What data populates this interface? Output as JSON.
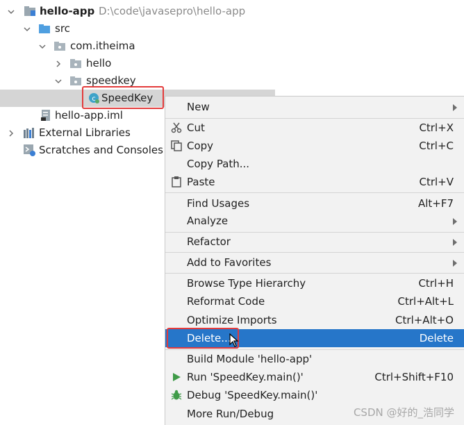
{
  "tree": {
    "project": {
      "name": "hello-app",
      "path": "D:\\code\\javasepro\\hello-app"
    },
    "src": "src",
    "package": "com.itheima",
    "hello": "hello",
    "speedkey": "speedkey",
    "speedkey_class": "SpeedKey",
    "iml": "hello-app.iml",
    "external": "External Libraries",
    "scratches": "Scratches and Consoles"
  },
  "menu": {
    "new": "New",
    "cut": "Cut",
    "cut_sc": "Ctrl+X",
    "copy": "Copy",
    "copy_sc": "Ctrl+C",
    "copy_path": "Copy Path...",
    "paste": "Paste",
    "paste_sc": "Ctrl+V",
    "find_usages": "Find Usages",
    "find_usages_sc": "Alt+F7",
    "analyze": "Analyze",
    "refactor": "Refactor",
    "add_favorites": "Add to Favorites",
    "browse_type": "Browse Type Hierarchy",
    "browse_type_sc": "Ctrl+H",
    "reformat": "Reformat Code",
    "reformat_sc": "Ctrl+Alt+L",
    "optimize": "Optimize Imports",
    "optimize_sc": "Ctrl+Alt+O",
    "delete": "Delete...",
    "delete_sc": "Delete",
    "build_module": "Build Module 'hello-app'",
    "run": "Run 'SpeedKey.main()'",
    "run_sc": "Ctrl+Shift+F10",
    "debug": "Debug 'SpeedKey.main()'",
    "more_run": "More Run/Debug"
  },
  "watermark": "CSDN @好的_浩同学",
  "colors": {
    "selection": "#2676c9",
    "highlight_box": "#e33b3b",
    "run_green": "#3f9b48"
  }
}
